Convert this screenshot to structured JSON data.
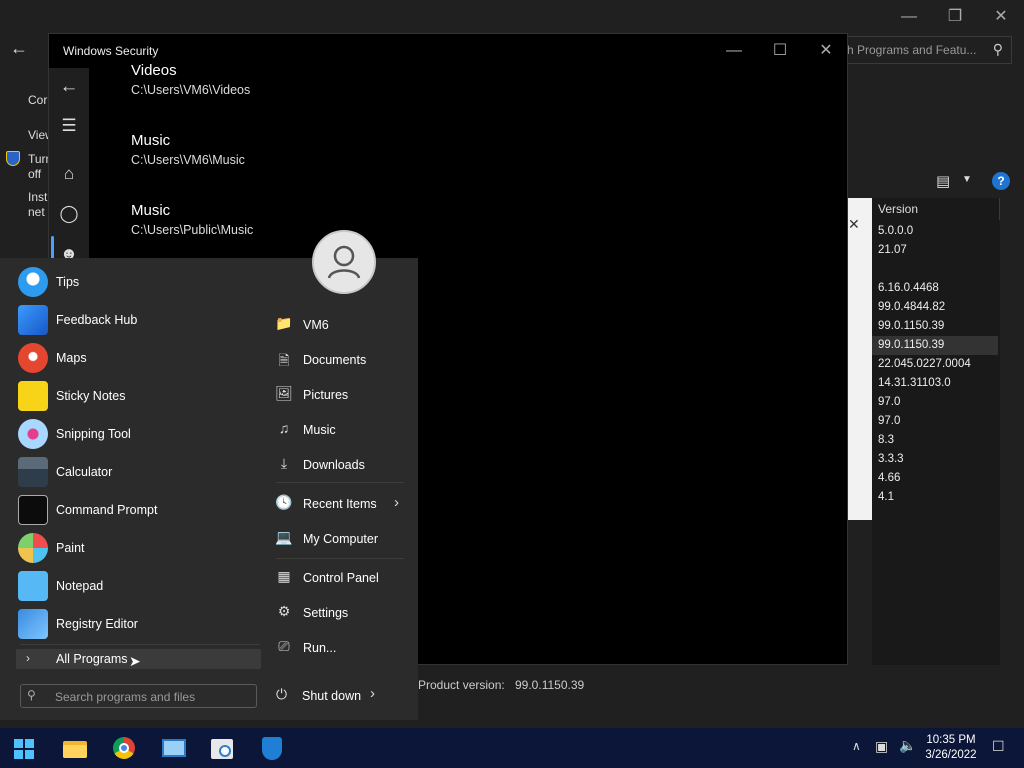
{
  "background_window": {
    "search_placeholder": "h Programs and Featu...",
    "left_panel": [
      "Cor",
      "View",
      "Turn",
      "off",
      "Inst",
      "net"
    ],
    "list_header_version": "Version",
    "versions": [
      "5.0.0.0",
      "21.07",
      "",
      "6.16.0.4468",
      "99.0.4844.82",
      "99.0.1150.39",
      "99.0.1150.39",
      "22.045.0227.0004",
      "14.31.31103.0",
      "97.0",
      "97.0",
      "8.3",
      "3.3.3",
      "4.66",
      "4.1"
    ],
    "selected_version_index": 6,
    "status_label": "Product version:",
    "status_value": "99.0.1150.39"
  },
  "security_window": {
    "title": "Windows Security",
    "folders": [
      {
        "name": "Videos",
        "path": "C:\\Users\\VM6\\Videos"
      },
      {
        "name": "Music",
        "path": "C:\\Users\\VM6\\Music"
      },
      {
        "name": "Music",
        "path": "C:\\Users\\Public\\Music"
      }
    ]
  },
  "start_menu": {
    "apps": [
      {
        "label": "Tips",
        "icon": "lightbulb-icon"
      },
      {
        "label": "Feedback Hub",
        "icon": "feedback-icon"
      },
      {
        "label": "Maps",
        "icon": "map-pin-icon"
      },
      {
        "label": "Sticky Notes",
        "icon": "sticky-note-icon"
      },
      {
        "label": "Snipping Tool",
        "icon": "scissors-icon"
      },
      {
        "label": "Calculator",
        "icon": "calculator-icon"
      },
      {
        "label": "Command Prompt",
        "icon": "terminal-icon"
      },
      {
        "label": "Paint",
        "icon": "palette-icon"
      },
      {
        "label": "Notepad",
        "icon": "notepad-icon"
      },
      {
        "label": "Registry Editor",
        "icon": "registry-icon"
      }
    ],
    "all_programs": "All Programs",
    "search_placeholder": "Search programs and files",
    "right_links": [
      {
        "label": "VM6",
        "icon": "user-folder-icon"
      },
      {
        "label": "Documents",
        "icon": "document-icon"
      },
      {
        "label": "Pictures",
        "icon": "picture-icon"
      },
      {
        "label": "Music",
        "icon": "music-note-icon"
      },
      {
        "label": "Downloads",
        "icon": "download-icon"
      },
      {
        "label": "Recent Items",
        "icon": "clock-icon"
      },
      {
        "label": "My Computer",
        "icon": "computer-icon"
      },
      {
        "label": "Control Panel",
        "icon": "control-panel-icon"
      },
      {
        "label": "Settings",
        "icon": "gear-icon"
      },
      {
        "label": "Run...",
        "icon": "run-icon"
      }
    ],
    "shutdown": "Shut down"
  },
  "taskbar": {
    "time": "10:35 PM",
    "date": "3/26/2022",
    "apps": [
      "start-icon",
      "file-explorer-icon",
      "chrome-icon",
      "control-panel-icon",
      "task-scheduler-icon",
      "windows-security-icon"
    ]
  }
}
